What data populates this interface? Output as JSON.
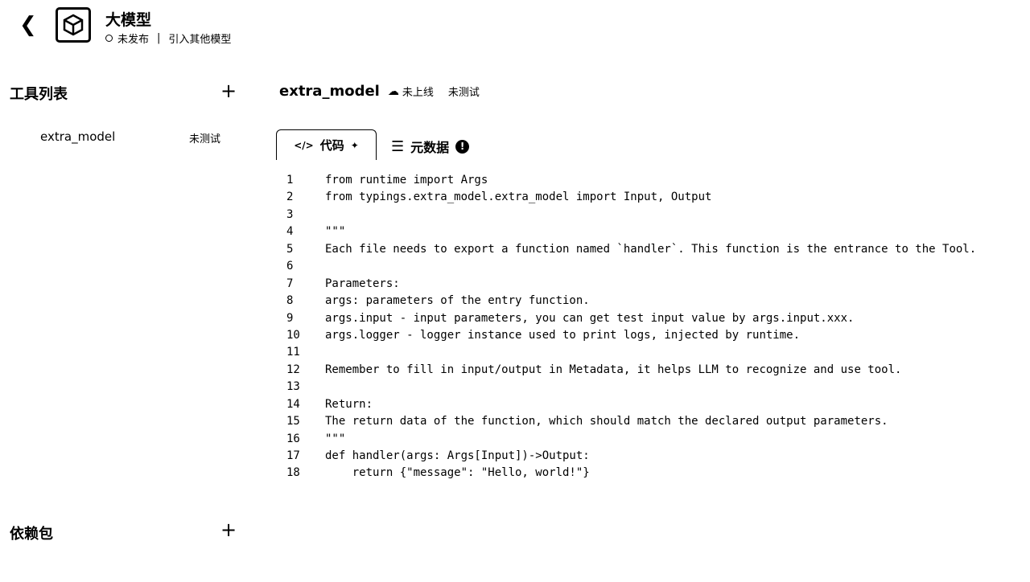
{
  "header": {
    "title": "大模型",
    "status": "未发布",
    "action": "引入其他模型"
  },
  "sidebar": {
    "tools_title": "工具列表",
    "tools": [
      {
        "name": "extra_model",
        "status": "未测试"
      }
    ],
    "deps_title": "依赖包"
  },
  "main": {
    "tool_name": "extra_model",
    "deploy_status": "未上线",
    "test_status": "未测试",
    "tabs": [
      {
        "label": "代码"
      },
      {
        "label": "元数据"
      }
    ],
    "code_lines": [
      "from runtime import Args",
      "from typings.extra_model.extra_model import Input, Output",
      "",
      "\"\"\"",
      "Each file needs to export a function named `handler`. This function is the entrance to the Tool.",
      "",
      "Parameters:",
      "args: parameters of the entry function.",
      "args.input - input parameters, you can get test input value by args.input.xxx.",
      "args.logger - logger instance used to print logs, injected by runtime.",
      "",
      "Remember to fill in input/output in Metadata, it helps LLM to recognize and use tool.",
      "",
      "Return:",
      "The return data of the function, which should match the declared output parameters.",
      "\"\"\"",
      "def handler(args: Args[Input])->Output:",
      "    return {\"message\": \"Hello, world!\"}"
    ]
  }
}
